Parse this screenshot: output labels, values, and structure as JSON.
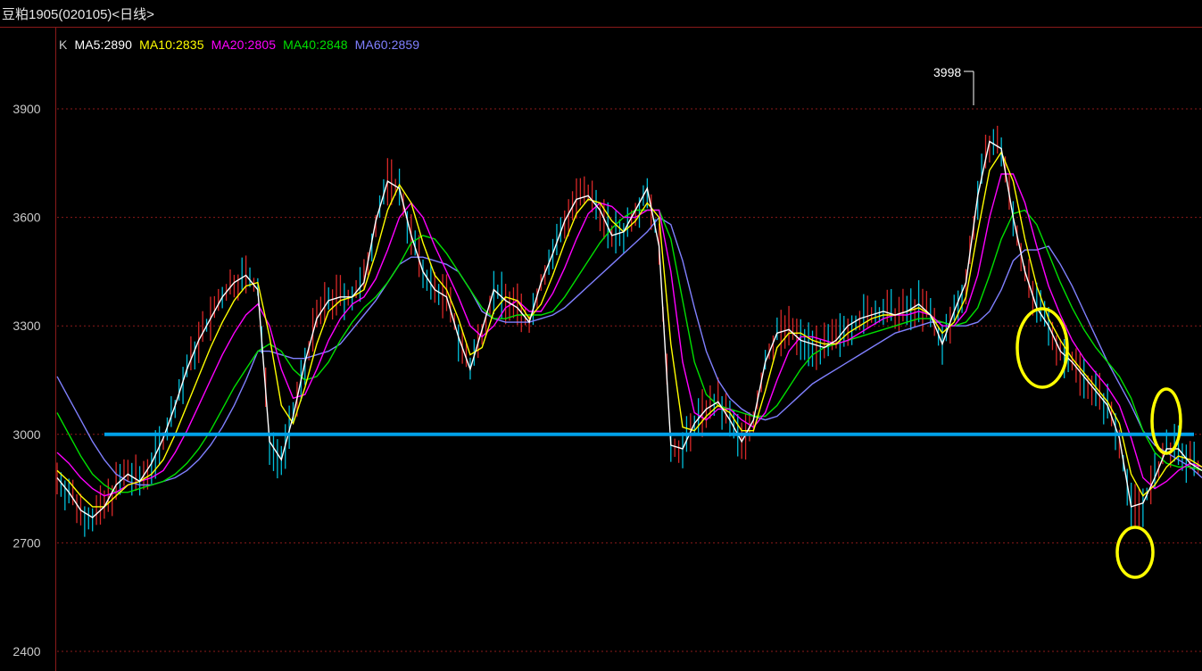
{
  "window": {
    "title": "豆粕1905(020105)<日线>"
  },
  "legend": {
    "k": "K",
    "ma5": "MA5:2890",
    "ma10": "MA10:2835",
    "ma20": "MA20:2805",
    "ma40": "MA40:2848",
    "ma60": "MA60:2859"
  },
  "colors": {
    "background": "#000000",
    "grid": "#8b1a1a",
    "axis_text": "#c8c8c8",
    "ma5": "#ffffff",
    "ma10": "#ffff00",
    "ma20": "#ff00ff",
    "ma40": "#00e000",
    "ma60": "#8080ff",
    "support_line": "#00a0e8",
    "annotation": "#ffff00"
  },
  "chart_data": {
    "type": "line",
    "ylim": [
      2400,
      4100
    ],
    "yticks": [
      3900,
      3600,
      3300,
      3000,
      2700,
      2400
    ],
    "peak_label": "3998",
    "support_level": 3000,
    "series": [
      {
        "name": "MA5",
        "values": [
          2880,
          2840,
          2790,
          2770,
          2800,
          2860,
          2890,
          2870,
          2920,
          2990,
          3080,
          3180,
          3260,
          3320,
          3380,
          3420,
          3440,
          3400,
          2980,
          2930,
          3050,
          3200,
          3320,
          3370,
          3380,
          3380,
          3420,
          3590,
          3700,
          3680,
          3550,
          3450,
          3400,
          3380,
          3270,
          3180,
          3290,
          3400,
          3370,
          3350,
          3310,
          3420,
          3500,
          3590,
          3650,
          3660,
          3620,
          3550,
          3560,
          3620,
          3680,
          3520,
          2970,
          2960,
          3030,
          3070,
          3090,
          3040,
          2980,
          3040,
          3200,
          3280,
          3290,
          3260,
          3250,
          3240,
          3260,
          3300,
          3320,
          3330,
          3340,
          3330,
          3340,
          3360,
          3330,
          3250,
          3340,
          3420,
          3660,
          3810,
          3790,
          3600,
          3450,
          3350,
          3300,
          3230,
          3200,
          3160,
          3120,
          3080,
          2990,
          2800,
          2810,
          2880,
          2960,
          2960,
          2920,
          2900
        ]
      },
      {
        "name": "MA10",
        "values": [
          2900,
          2870,
          2830,
          2800,
          2800,
          2830,
          2860,
          2870,
          2890,
          2930,
          3000,
          3080,
          3160,
          3240,
          3310,
          3370,
          3410,
          3420,
          3270,
          3080,
          3030,
          3130,
          3250,
          3340,
          3370,
          3380,
          3400,
          3500,
          3620,
          3690,
          3640,
          3530,
          3440,
          3400,
          3320,
          3220,
          3240,
          3340,
          3380,
          3370,
          3320,
          3360,
          3440,
          3530,
          3610,
          3650,
          3640,
          3590,
          3560,
          3590,
          3640,
          3600,
          3250,
          3020,
          3010,
          3050,
          3080,
          3060,
          3010,
          3010,
          3120,
          3240,
          3280,
          3280,
          3260,
          3250,
          3250,
          3280,
          3300,
          3320,
          3330,
          3330,
          3340,
          3350,
          3330,
          3280,
          3310,
          3380,
          3560,
          3730,
          3780,
          3700,
          3540,
          3410,
          3320,
          3260,
          3210,
          3170,
          3130,
          3090,
          3030,
          2890,
          2830,
          2860,
          2910,
          2940,
          2930,
          2910
        ]
      },
      {
        "name": "MA20",
        "values": [
          2950,
          2920,
          2880,
          2850,
          2830,
          2840,
          2860,
          2870,
          2880,
          2900,
          2950,
          3010,
          3080,
          3150,
          3220,
          3280,
          3330,
          3360,
          3300,
          3180,
          3100,
          3110,
          3180,
          3260,
          3320,
          3360,
          3380,
          3430,
          3510,
          3600,
          3640,
          3600,
          3520,
          3450,
          3380,
          3300,
          3270,
          3300,
          3350,
          3370,
          3340,
          3340,
          3390,
          3460,
          3540,
          3610,
          3640,
          3630,
          3600,
          3600,
          3620,
          3620,
          3450,
          3200,
          3060,
          3040,
          3070,
          3070,
          3040,
          3020,
          3060,
          3150,
          3230,
          3270,
          3270,
          3260,
          3250,
          3260,
          3280,
          3300,
          3320,
          3330,
          3330,
          3340,
          3330,
          3300,
          3300,
          3340,
          3440,
          3600,
          3720,
          3720,
          3640,
          3520,
          3410,
          3330,
          3260,
          3210,
          3170,
          3130,
          3080,
          2990,
          2880,
          2850,
          2870,
          2900,
          2920,
          2910
        ]
      },
      {
        "name": "MA40",
        "values": [
          3060,
          3000,
          2940,
          2890,
          2860,
          2840,
          2840,
          2850,
          2860,
          2870,
          2890,
          2920,
          2960,
          3010,
          3070,
          3130,
          3180,
          3230,
          3250,
          3230,
          3180,
          3150,
          3160,
          3200,
          3260,
          3310,
          3350,
          3380,
          3420,
          3470,
          3530,
          3550,
          3540,
          3500,
          3450,
          3400,
          3350,
          3320,
          3320,
          3330,
          3330,
          3330,
          3340,
          3380,
          3430,
          3480,
          3530,
          3570,
          3600,
          3620,
          3620,
          3620,
          3540,
          3370,
          3200,
          3110,
          3080,
          3070,
          3060,
          3050,
          3050,
          3080,
          3130,
          3180,
          3220,
          3240,
          3250,
          3260,
          3270,
          3280,
          3290,
          3300,
          3310,
          3320,
          3320,
          3310,
          3300,
          3310,
          3350,
          3440,
          3540,
          3610,
          3620,
          3580,
          3500,
          3420,
          3350,
          3290,
          3240,
          3200,
          3160,
          3100,
          3010,
          2950,
          2920,
          2910,
          2910,
          2900
        ]
      },
      {
        "name": "MA60",
        "values": [
          3160,
          3100,
          3040,
          2980,
          2930,
          2890,
          2870,
          2860,
          2860,
          2870,
          2880,
          2900,
          2930,
          2970,
          3020,
          3080,
          3150,
          3230,
          3230,
          3220,
          3210,
          3210,
          3220,
          3230,
          3250,
          3290,
          3330,
          3370,
          3420,
          3470,
          3490,
          3490,
          3480,
          3470,
          3450,
          3400,
          3340,
          3320,
          3310,
          3310,
          3310,
          3320,
          3330,
          3350,
          3380,
          3410,
          3440,
          3470,
          3500,
          3530,
          3560,
          3600,
          3580,
          3480,
          3350,
          3230,
          3150,
          3100,
          3070,
          3050,
          3040,
          3050,
          3080,
          3110,
          3140,
          3160,
          3180,
          3200,
          3220,
          3240,
          3260,
          3280,
          3290,
          3300,
          3310,
          3310,
          3300,
          3300,
          3310,
          3340,
          3400,
          3480,
          3510,
          3510,
          3520,
          3470,
          3410,
          3340,
          3270,
          3200,
          3140,
          3080,
          3010,
          2970,
          2950,
          2930,
          2910,
          2880
        ]
      }
    ]
  }
}
